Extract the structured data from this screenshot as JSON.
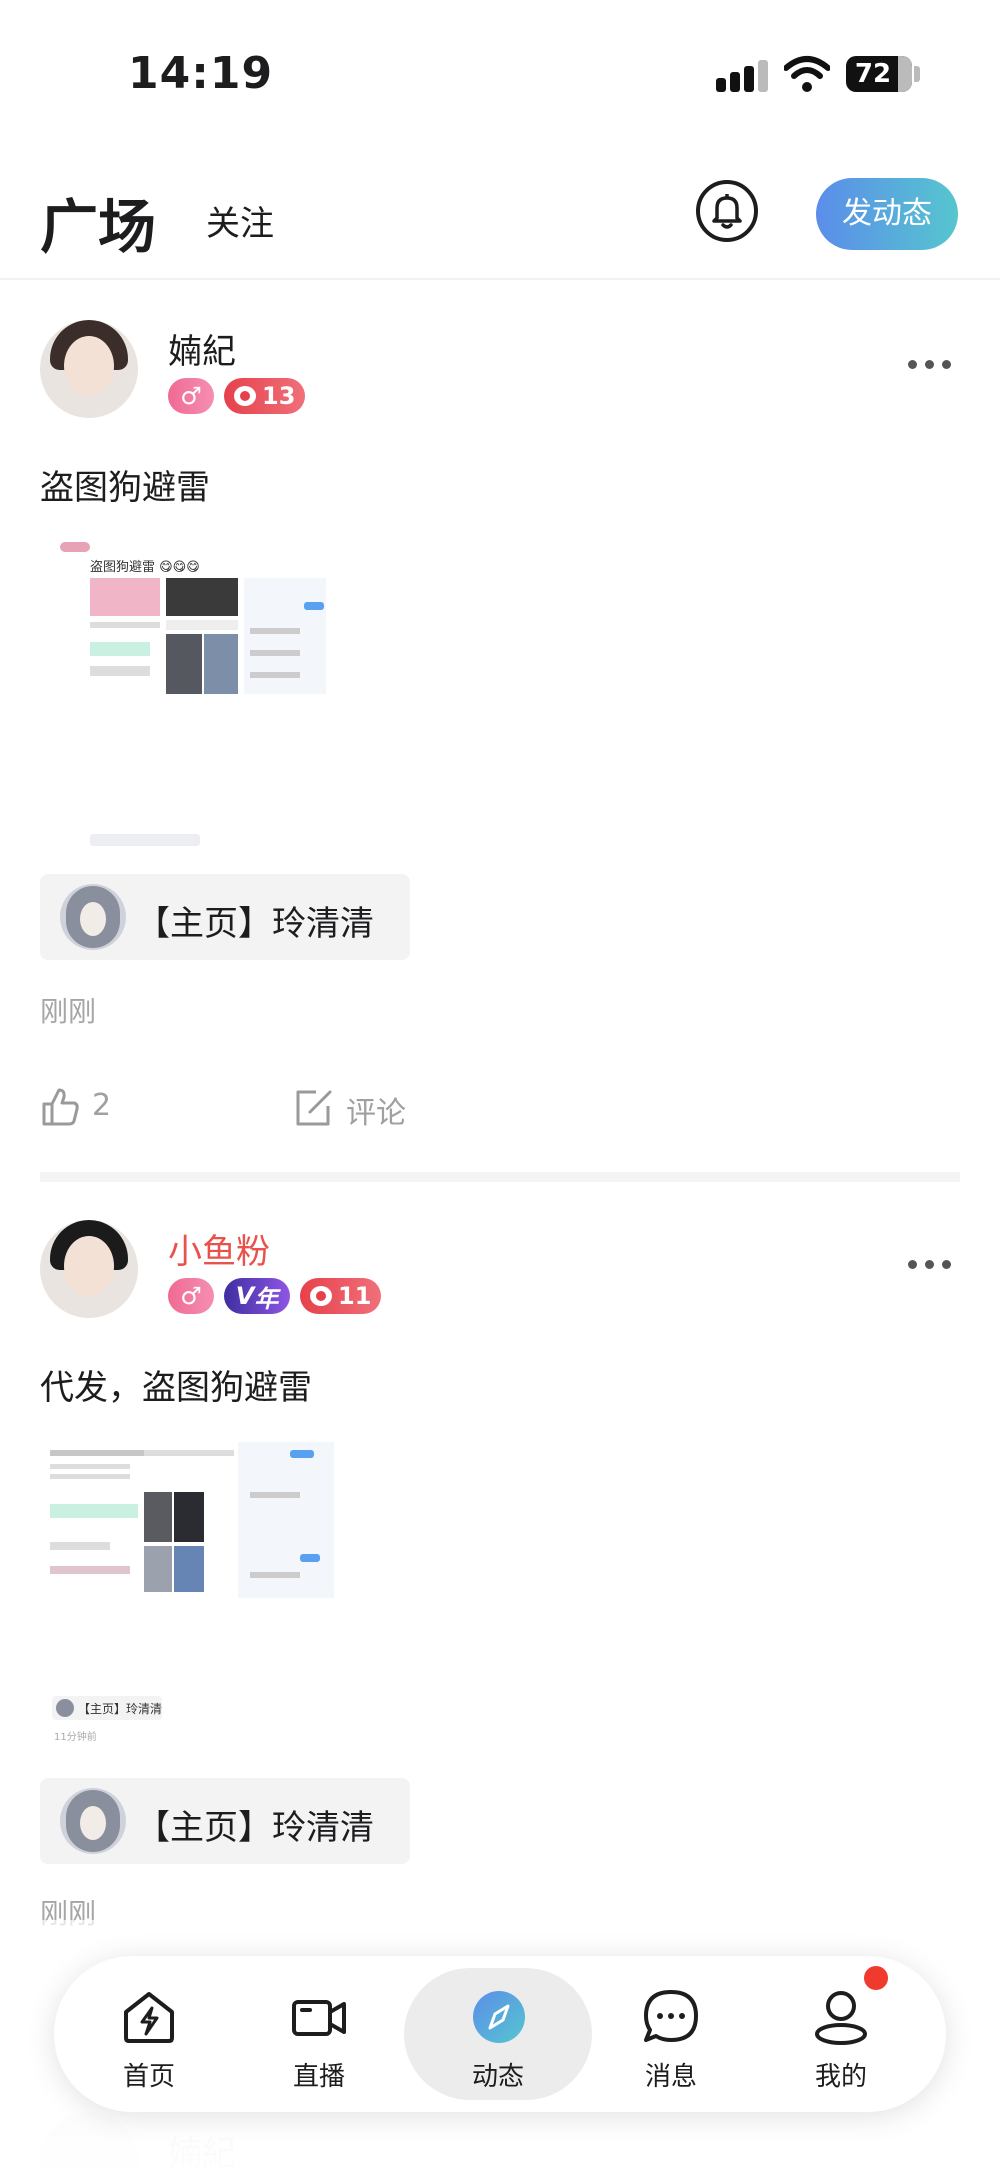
{
  "status_bar": {
    "time": "14:19",
    "battery": "72"
  },
  "header": {
    "tab_square": "广场",
    "tab_follow": "关注",
    "post_button": "发动态"
  },
  "posts": [
    {
      "username": "婻紀",
      "username_color": "#1d1d1f",
      "heart_level": "13",
      "text": "盗图狗避雷",
      "thumb_caption": "盗图狗避雷 😋😋😋",
      "link_title": "【主页】玲清清",
      "time": "刚刚",
      "likes": "2",
      "comment_label": "评论"
    },
    {
      "username": "小鱼粉",
      "username_color": "#e8524a",
      "vip_badge": "年",
      "heart_level": "11",
      "text": "代发，盗图狗避雷",
      "thumb_link": "【主页】玲清清",
      "thumb_time": "11分钟前",
      "link_title": "【主页】玲清清",
      "time": "刚刚"
    }
  ],
  "next_post": {
    "username": "婻紀"
  },
  "nav": {
    "items": [
      {
        "label": "首页",
        "icon": "home-lightning-icon"
      },
      {
        "label": "直播",
        "icon": "video-camera-icon"
      },
      {
        "label": "动态",
        "icon": "compass-icon",
        "active": true
      },
      {
        "label": "消息",
        "icon": "chat-bubble-icon"
      },
      {
        "label": "我的",
        "icon": "user-profile-icon",
        "has_notification": true
      }
    ]
  },
  "colors": {
    "accent_start": "#5b8dea",
    "accent_end": "#56c6cf",
    "notification": "#f03a2e"
  }
}
